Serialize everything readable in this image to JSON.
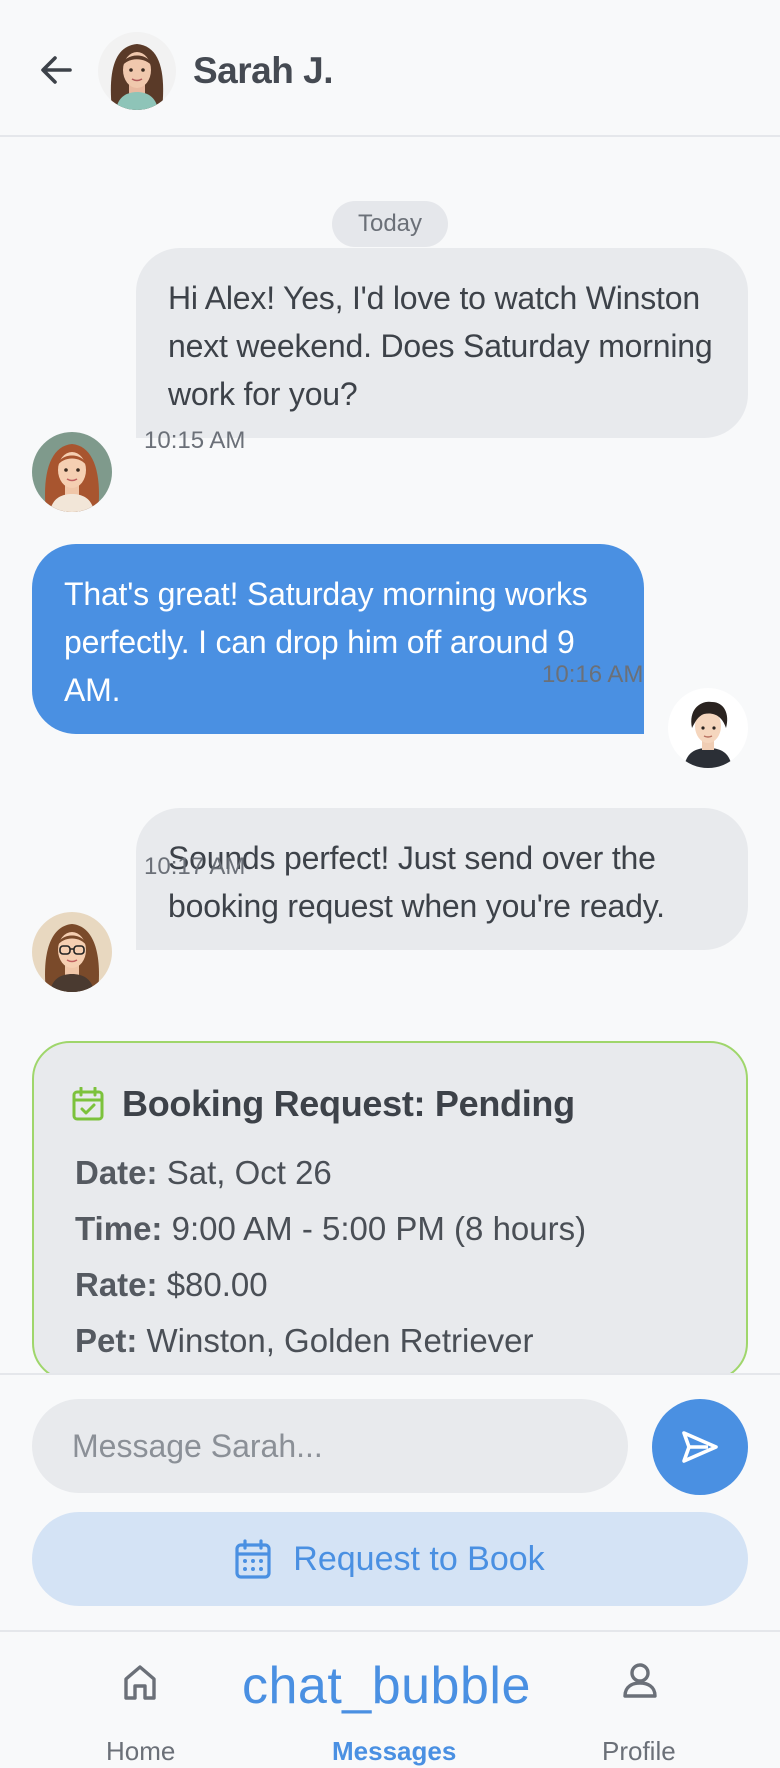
{
  "header": {
    "contact_name": "Sarah J."
  },
  "chat": {
    "date_label": "Today",
    "messages": [
      {
        "direction": "in",
        "text": "Hi Alex! Yes, I'd love to watch Winston next weekend. Does Saturday morning work for you?",
        "time": "10:15 AM"
      },
      {
        "direction": "out",
        "text": "That's great! Saturday morning works perfectly. I can drop him off around 9 AM.",
        "time": "10:16 AM"
      },
      {
        "direction": "in",
        "text": "Sounds perfect! Just send over the booking request when you're ready.",
        "time": "10:17 AM"
      }
    ],
    "booking": {
      "title": "Booking Request: Pending",
      "date_label": "Date:",
      "date_value": "Sat, Oct 26",
      "time_label": "Time:",
      "time_value": "9:00 AM - 5:00 PM (8 hours)",
      "rate_label": "Rate:",
      "rate_value": "$80.00",
      "pet_label": "Pet:",
      "pet_value": "Winston, Golden Retriever",
      "border_color": "#9fd66b",
      "icon": "calendar-check-icon"
    }
  },
  "composer": {
    "placeholder": "Message Sarah...",
    "request_button": "Request to Book"
  },
  "nav": {
    "home": "Home",
    "messages_icon_text": "chat_bubble",
    "messages": "Messages",
    "profile": "Profile"
  },
  "colors": {
    "accent": "#4a90e2",
    "outgoing_bubble": "#4a90e2",
    "incoming_bubble": "#e8eaed",
    "booking_border": "#9fd66b"
  }
}
